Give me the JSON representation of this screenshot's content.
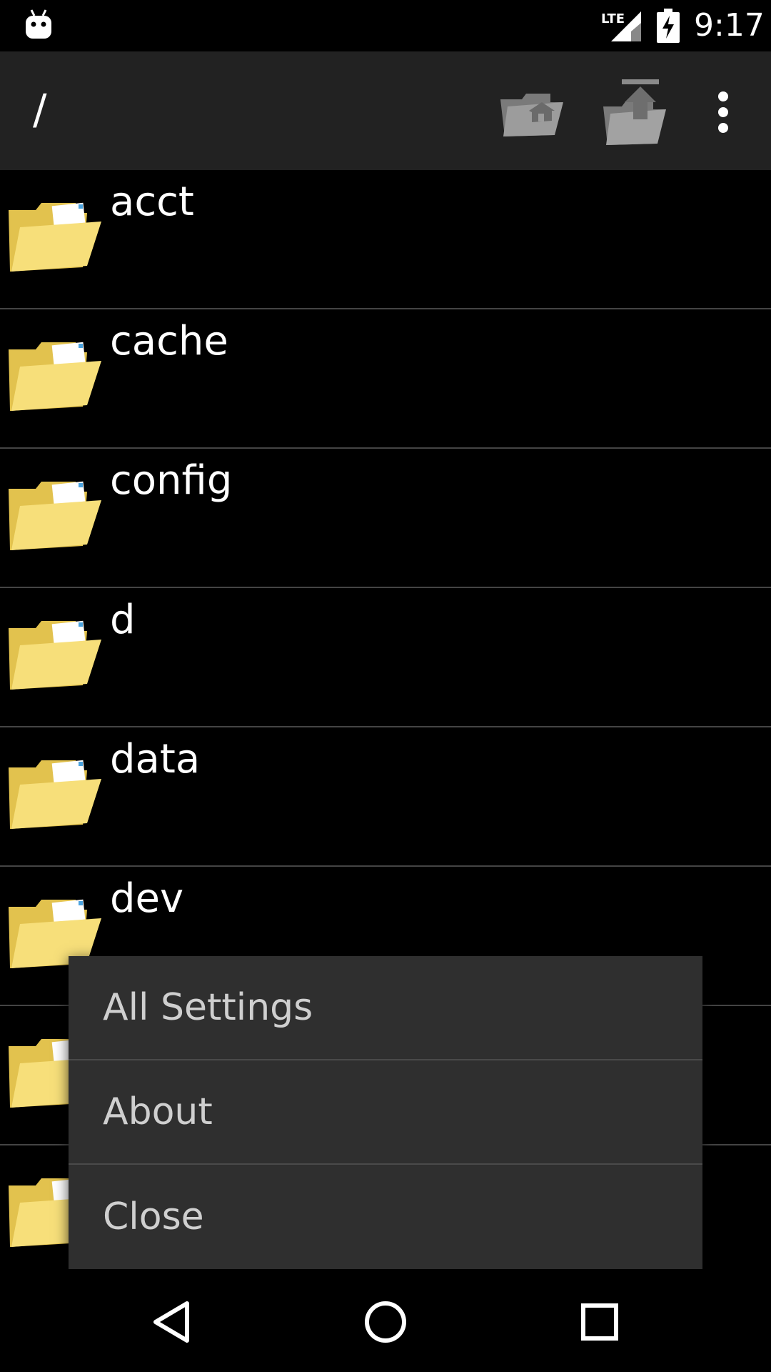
{
  "status_bar": {
    "network": "LTE",
    "time": "9:17",
    "icons": [
      "android-icon",
      "lte-signal-icon",
      "battery-charging-icon"
    ]
  },
  "action_bar": {
    "path": "/",
    "icons": [
      "home-folder-icon",
      "up-folder-icon",
      "overflow-menu-icon"
    ]
  },
  "files": [
    {
      "name": "acct"
    },
    {
      "name": "cache"
    },
    {
      "name": "config"
    },
    {
      "name": "d"
    },
    {
      "name": "data"
    },
    {
      "name": "dev"
    },
    {
      "name": ""
    },
    {
      "name": ""
    }
  ],
  "menu": {
    "items": [
      {
        "label": "All Settings"
      },
      {
        "label": "About"
      },
      {
        "label": "Close"
      }
    ]
  },
  "nav_bar": {
    "icons": [
      "back-icon",
      "home-icon",
      "recents-icon"
    ]
  },
  "colors": {
    "folder_fill": "#F7DF7A",
    "folder_dark": "#E2C24E",
    "action_bar": "#222222",
    "menu_bg": "#2F2F2F",
    "menu_text": "#CFCFCF"
  }
}
